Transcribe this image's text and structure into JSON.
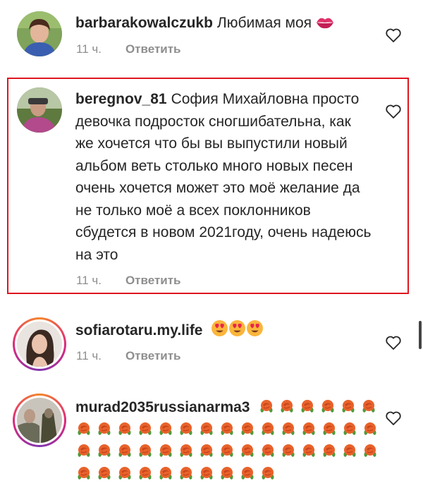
{
  "comments": [
    {
      "username": "barbarakowalczukb",
      "text": "Любимая моя",
      "time": "11 ч.",
      "reply": "Ответить",
      "emoji": "kiss-lips"
    },
    {
      "username": "beregnov_81",
      "text": "София Михайловна просто девочка подросток сногшибательна, как же хочется что бы вы выпустили новый альбом веть столько много новых песен очень хочется может это моё желание да не только моё а всех поклонников сбудется в новом 2021году, очень надеюсь на это",
      "time": "11 ч.",
      "reply": "Ответить",
      "highlighted": true
    },
    {
      "username": "sofiarotaru.my.life",
      "text": "",
      "time": "11 ч.",
      "reply": "Ответить",
      "emoji": "heart-eyes-face x3"
    },
    {
      "username": "murad2035russianarma3",
      "text": "",
      "emoji": "rose x many"
    }
  ],
  "colors": {
    "text": "#262626",
    "meta": "#8e8e8e",
    "highlight_border": "#e0151f"
  }
}
